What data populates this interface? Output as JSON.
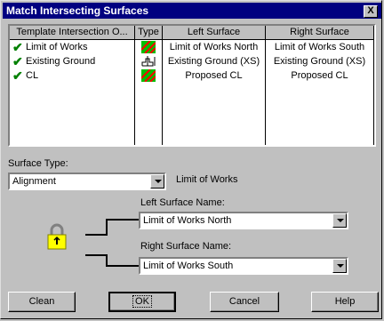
{
  "window": {
    "title": "Match Intersecting Surfaces",
    "close_label": "X"
  },
  "table": {
    "headers": [
      "Template Intersection O...",
      "Type",
      "Left Surface",
      "Right Surface"
    ],
    "rows": [
      {
        "name": "Limit of Works",
        "type_icon": "hatched-surface-icon",
        "left": "Limit of Works North",
        "right": "Limit of Works South"
      },
      {
        "name": "Existing Ground",
        "type_icon": "cross-section-icon",
        "left": "Existing Ground (XS)",
        "right": "Existing Ground (XS)"
      },
      {
        "name": "CL",
        "type_icon": "hatched-surface-icon",
        "left": "Proposed CL",
        "right": "Proposed CL"
      }
    ]
  },
  "surface_type": {
    "label": "Surface Type:",
    "value": "Alignment",
    "current_name": "Limit of Works"
  },
  "left_surface": {
    "label": "Left Surface Name:",
    "value": "Limit of Works North"
  },
  "right_surface": {
    "label": "Right Surface Name:",
    "value": "Limit of Works South"
  },
  "buttons": {
    "clean": "Clean",
    "ok": "OK",
    "cancel": "Cancel",
    "help": "Help"
  },
  "colors": {
    "title_bar": "#000080",
    "check": "#008000",
    "face": "#c0c0c0"
  }
}
